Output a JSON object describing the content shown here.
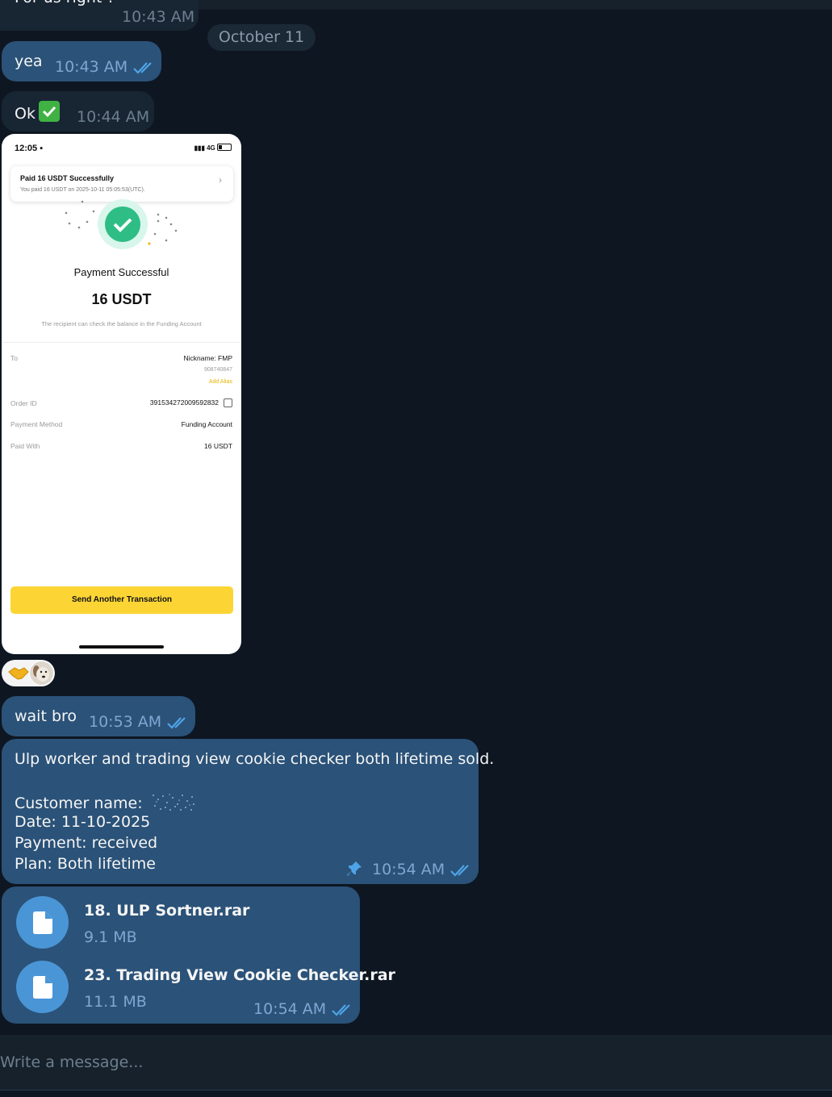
{
  "messages": {
    "m0": {
      "text": "For us right ?",
      "time": "10:43 AM"
    },
    "date_separator": "October 11",
    "m1": {
      "text": "yea",
      "time": "10:43 AM"
    },
    "m2": {
      "text": "Ok",
      "emoji": "check-mark-emoji",
      "time": "10:44 AM"
    },
    "m3": {
      "text": "wait bro",
      "time": "10:53 AM"
    },
    "m4": {
      "line1": "Ulp worker and trading view cookie checker both lifetime sold.",
      "customer_label": "Customer name:",
      "date": "Date: 11-10-2025",
      "payment": "Payment: received",
      "plan": "Plan: Both lifetime",
      "time": "10:54 AM",
      "pinned": true
    },
    "m5": {
      "files": [
        {
          "name": "18. ULP Sortner.rar",
          "size": "9.1 MB"
        },
        {
          "name": "23. Trading View Cookie Checker.rar",
          "size": "11.1 MB"
        }
      ],
      "time": "10:54 AM"
    }
  },
  "screenshot": {
    "status_time": "12:05",
    "status_net": "4G",
    "notif_title": "Paid 16 USDT Successfully",
    "notif_sub": "You paid 16 USDT on 2025-10-11 05:05:53(UTC).",
    "title": "Payment Successful",
    "amount": "16 USDT",
    "note": "The recipient can check the balance in the Funding Account",
    "to_label": "To",
    "to_value": "Nickname: FMP",
    "to_id": "908740847",
    "add_alias": "Add Alias",
    "order_label": "Order ID",
    "order_value": "391534272009592832",
    "method_label": "Payment Method",
    "method_value": "Funding Account",
    "paid_label": "Paid With",
    "paid_value": "16 USDT",
    "button": "Send Another Transaction"
  },
  "reactions": [
    "handshake-emoji",
    "dog-avatar"
  ],
  "composer": {
    "placeholder": "Write a message..."
  },
  "colors": {
    "background": "#0e1621",
    "incoming": "#182533",
    "outgoing": "#2b5278",
    "accent": "#4a95d6",
    "binance_yellow": "#fcd535"
  }
}
